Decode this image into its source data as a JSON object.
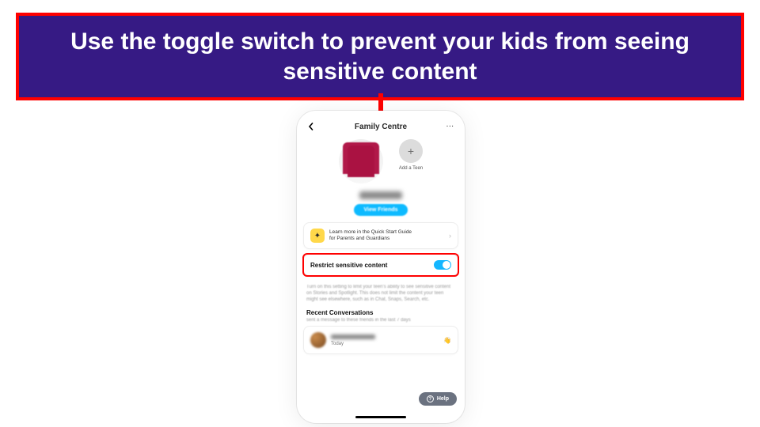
{
  "callout": {
    "text": "Use the toggle switch to prevent your kids from seeing sensitive content"
  },
  "colors": {
    "accent": "#14b6ff",
    "callout_bg": "#361a84",
    "highlight": "#ff0000"
  },
  "phone": {
    "header": {
      "title": "Family Centre"
    },
    "add_teen": {
      "label": "Add a Teen",
      "plus": "+"
    },
    "view_friends_btn": "View Friends",
    "quick_guide": {
      "icon_glyph": "✦",
      "line1": "Learn more in the Quick Start Guide",
      "line2": "for Parents and Guardians"
    },
    "restrict": {
      "label": "Restrict sensitive content",
      "enabled": true,
      "description": "Turn on this setting to limit your teen's ability to see sensitive content on Stories and Spotlight. This does not limit the content your teen might see elsewhere, such as in Chat, Snaps, Search, etc."
    },
    "recent": {
      "title": "Recent Conversations",
      "subtitle": "sent a message to these friends in the last 7 days",
      "items": [
        {
          "time": "Today"
        }
      ]
    },
    "help_btn": "Help"
  }
}
